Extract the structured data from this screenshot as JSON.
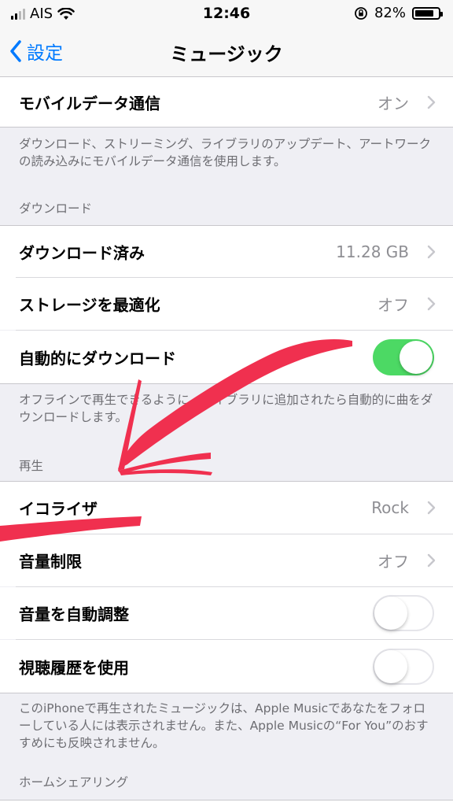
{
  "status_bar": {
    "carrier": "AIS",
    "time": "12:46",
    "battery": "82%",
    "battery_level": 0.82
  },
  "nav": {
    "back_label": "設定",
    "title": "ミュージック"
  },
  "cells": {
    "mobile_data": {
      "label": "モバイルデータ通信",
      "value": "オン"
    },
    "downloaded": {
      "label": "ダウンロード済み",
      "value": "11.28 GB"
    },
    "optimize_storage": {
      "label": "ストレージを最適化",
      "value": "オフ"
    },
    "auto_download": {
      "label": "自動的にダウンロード",
      "toggle": "on"
    },
    "eq": {
      "label": "イコライザ",
      "value": "Rock"
    },
    "volume_limit": {
      "label": "音量制限",
      "value": "オフ"
    },
    "sound_check": {
      "label": "音量を自動調整",
      "toggle": "off"
    },
    "listening_history": {
      "label": "視聴履歴を使用",
      "toggle": "off"
    }
  },
  "footers": {
    "mobile_data": "ダウンロード、ストリーミング、ライブラリのアップデート、アートワークの読み込みにモバイルデータ通信を使用します。",
    "auto_download": "オフラインで再生できるように、ライブラリに追加されたら自動的に曲をダウンロードします。",
    "history": "このiPhoneで再生されたミュージックは、Apple Musicであなたをフォローしている人には表示されません。また、Apple Musicの“For You”のおすすめにも反映されません。"
  },
  "sections": {
    "download": "ダウンロード",
    "playback": "再生",
    "home_sharing": "ホームシェアリング"
  },
  "colors": {
    "accent": "#007aff",
    "toggle_on": "#4cd964",
    "annotation": "#f0304f"
  }
}
